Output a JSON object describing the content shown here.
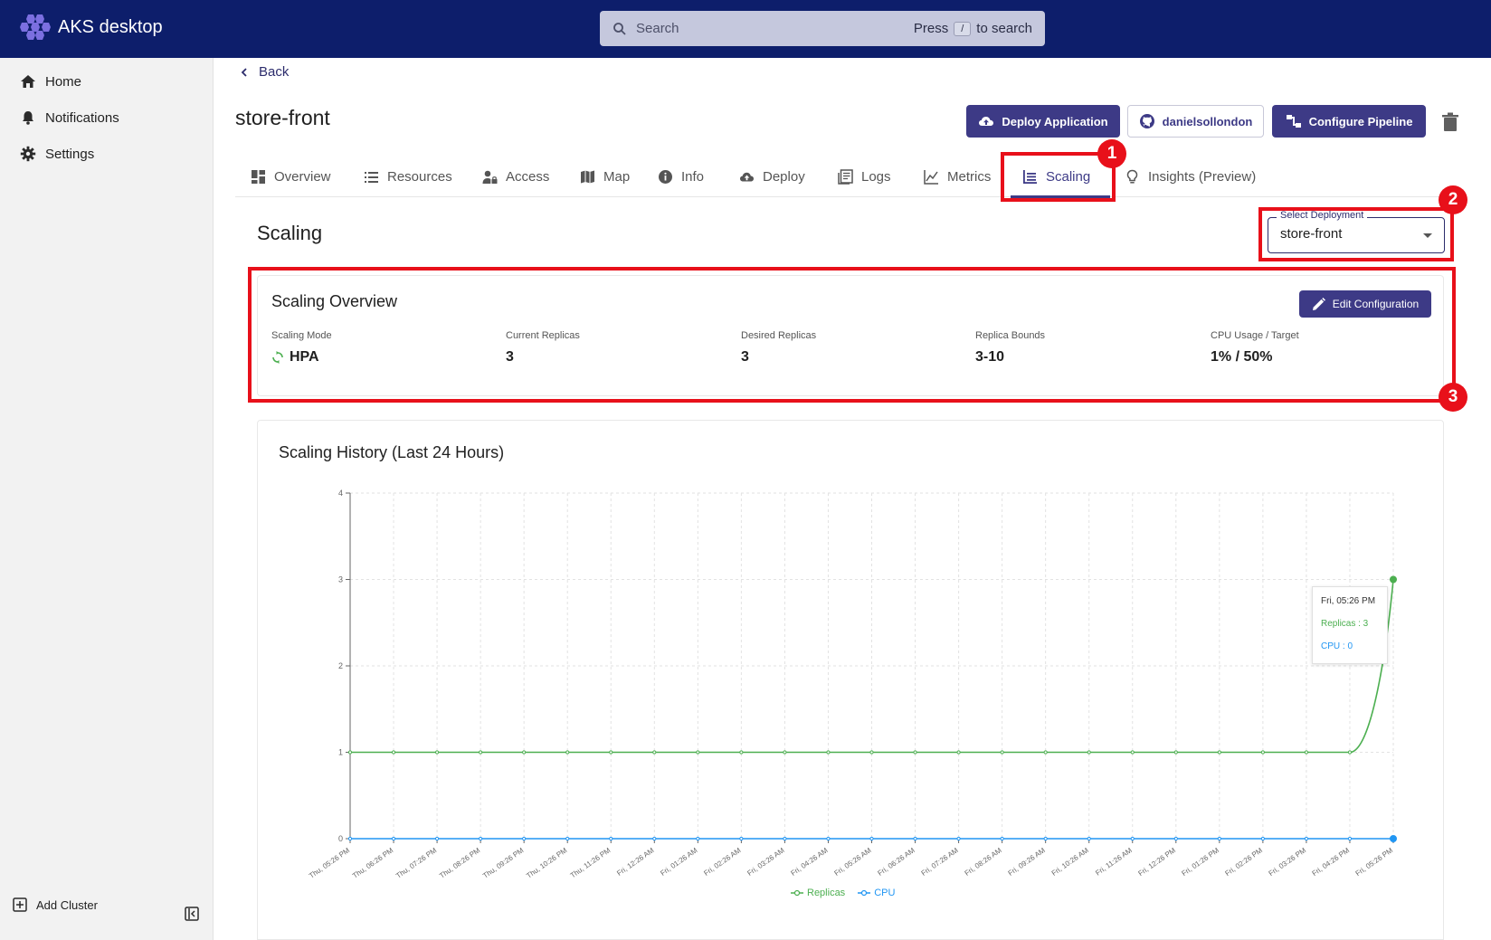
{
  "app": {
    "title": "AKS desktop"
  },
  "search": {
    "placeholder": "Search",
    "hint_prefix": "Press",
    "hint_key": "/",
    "hint_suffix": "to search"
  },
  "sidebar": {
    "items": [
      {
        "label": "Home",
        "icon": "home-icon"
      },
      {
        "label": "Notifications",
        "icon": "bell-icon"
      },
      {
        "label": "Settings",
        "icon": "gear-icon"
      }
    ],
    "add_cluster": "Add Cluster"
  },
  "back": "Back",
  "page": {
    "title": "store-front"
  },
  "actions": {
    "deploy": "Deploy Application",
    "github_user": "danielsollondon",
    "pipeline": "Configure Pipeline"
  },
  "tabs": [
    {
      "label": "Overview",
      "icon": "grid-icon"
    },
    {
      "label": "Resources",
      "icon": "list-icon"
    },
    {
      "label": "Access",
      "icon": "user-lock-icon"
    },
    {
      "label": "Map",
      "icon": "map-icon"
    },
    {
      "label": "Info",
      "icon": "info-icon"
    },
    {
      "label": "Deploy",
      "icon": "cloud-upload-icon"
    },
    {
      "label": "Logs",
      "icon": "logs-icon"
    },
    {
      "label": "Metrics",
      "icon": "line-chart-icon"
    },
    {
      "label": "Scaling",
      "icon": "scaling-icon",
      "active": true
    },
    {
      "label": "Insights (Preview)",
      "icon": "lightbulb-icon"
    }
  ],
  "scaling": {
    "title": "Scaling",
    "select_label": "Select Deployment",
    "select_value": "store-front",
    "overview_title": "Scaling Overview",
    "edit_button": "Edit Configuration",
    "stats": [
      {
        "label": "Scaling Mode",
        "value": "HPA"
      },
      {
        "label": "Current Replicas",
        "value": "3"
      },
      {
        "label": "Desired Replicas",
        "value": "3"
      },
      {
        "label": "Replica Bounds",
        "value": "3-10"
      },
      {
        "label": "CPU Usage / Target",
        "value": "1% / 50%"
      }
    ]
  },
  "chart_title": "Scaling History (Last 24 Hours)",
  "tooltip": {
    "time": "Fri, 05:26 PM",
    "replicas": "Replicas : 3",
    "cpu": "CPU : 0"
  },
  "annotations": [
    "1",
    "2",
    "3"
  ],
  "colors": {
    "topbar": "#0d1e6b",
    "primary": "#3d3a86",
    "replicas": "#4caf50",
    "cpu": "#2196f3",
    "annotation": "#e8101a"
  },
  "chart_data": {
    "type": "line",
    "title": "Scaling History (Last 24 Hours)",
    "x": [
      "Thu, 05:26 PM",
      "Thu, 06:26 PM",
      "Thu, 07:26 PM",
      "Thu, 08:26 PM",
      "Thu, 09:26 PM",
      "Thu, 10:26 PM",
      "Thu, 11:26 PM",
      "Fri, 12:26 AM",
      "Fri, 01:26 AM",
      "Fri, 02:26 AM",
      "Fri, 03:26 AM",
      "Fri, 04:26 AM",
      "Fri, 05:26 AM",
      "Fri, 06:26 AM",
      "Fri, 07:26 AM",
      "Fri, 08:26 AM",
      "Fri, 09:26 AM",
      "Fri, 10:26 AM",
      "Fri, 11:26 AM",
      "Fri, 12:26 PM",
      "Fri, 01:26 PM",
      "Fri, 02:26 PM",
      "Fri, 03:26 PM",
      "Fri, 04:26 PM",
      "Fri, 05:26 PM"
    ],
    "series": [
      {
        "name": "Replicas",
        "color": "#4caf50",
        "values": [
          1,
          1,
          1,
          1,
          1,
          1,
          1,
          1,
          1,
          1,
          1,
          1,
          1,
          1,
          1,
          1,
          1,
          1,
          1,
          1,
          1,
          1,
          1,
          1,
          3
        ]
      },
      {
        "name": "CPU",
        "color": "#2196f3",
        "values": [
          0,
          0,
          0,
          0,
          0,
          0,
          0,
          0,
          0,
          0,
          0,
          0,
          0,
          0,
          0,
          0,
          0,
          0,
          0,
          0,
          0,
          0,
          0,
          0,
          0
        ]
      }
    ],
    "ylim": [
      0,
      4
    ],
    "yticks": [
      0,
      1,
      2,
      3,
      4
    ],
    "grid": true,
    "legend": "bottom-center"
  }
}
